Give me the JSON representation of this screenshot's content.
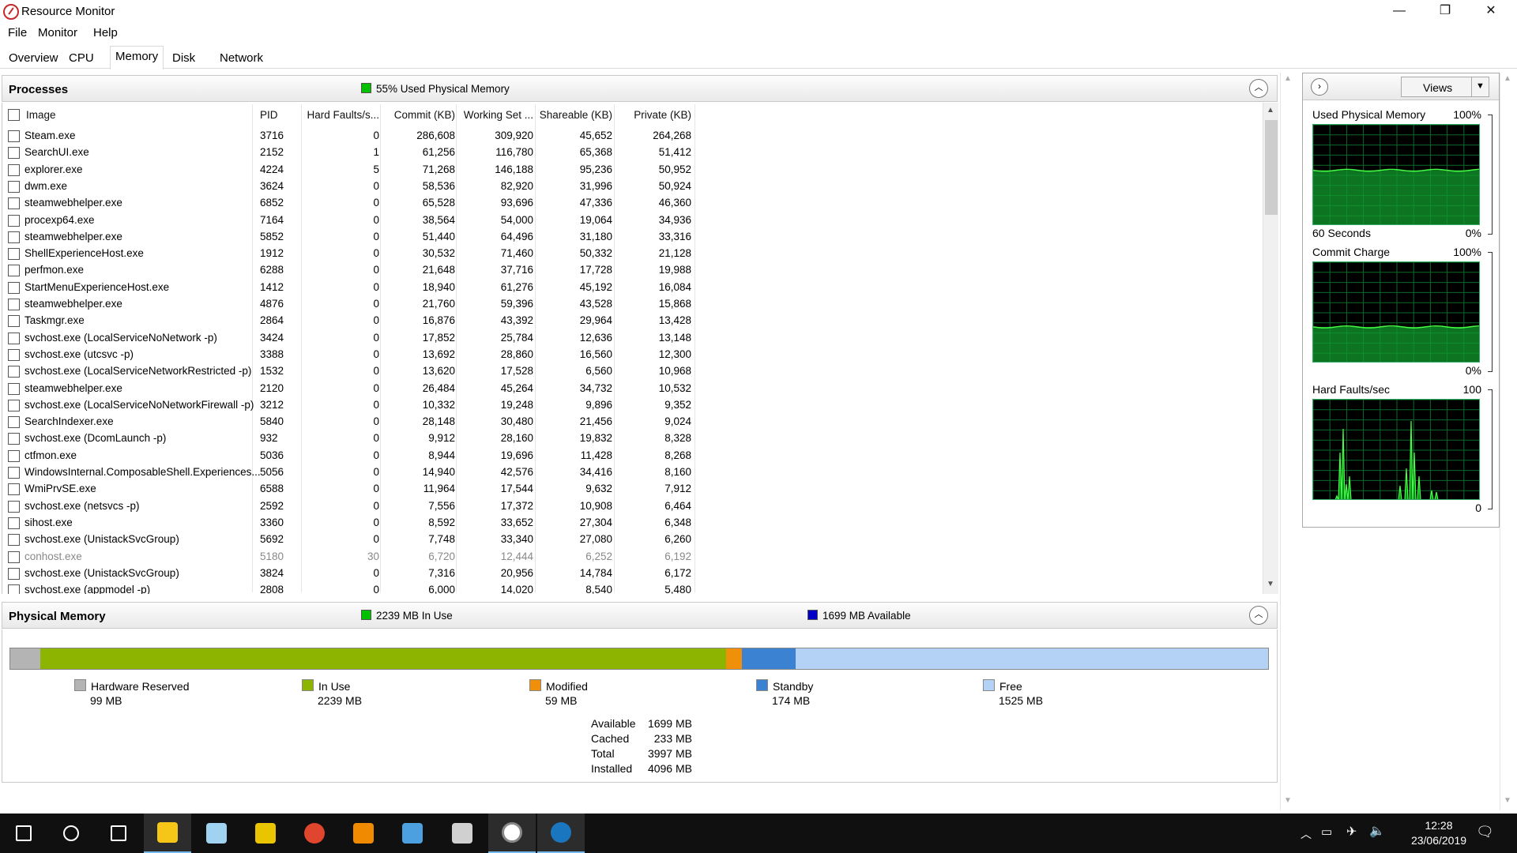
{
  "window": {
    "title": "Resource Monitor",
    "minimize_glyph": "—",
    "restore_glyph": "❐",
    "close_glyph": "✕"
  },
  "menu": [
    "File",
    "Monitor",
    "Help"
  ],
  "tabs": [
    {
      "label": "Overview",
      "active": false
    },
    {
      "label": "CPU",
      "active": false
    },
    {
      "label": "Memory",
      "active": true
    },
    {
      "label": "Disk",
      "active": false
    },
    {
      "label": "Network",
      "active": false
    }
  ],
  "processes": {
    "title": "Processes",
    "status": "55% Used Physical Memory",
    "status_color": "#00c000",
    "columns": [
      "Image",
      "PID",
      "Hard Faults/s...",
      "Commit (KB)",
      "Working Set ...",
      "Shareable (KB)",
      "Private (KB)"
    ],
    "rows": [
      [
        "Steam.exe",
        "3716",
        "0",
        "286,608",
        "309,920",
        "45,652",
        "264,268"
      ],
      [
        "SearchUI.exe",
        "2152",
        "1",
        "61,256",
        "116,780",
        "65,368",
        "51,412"
      ],
      [
        "explorer.exe",
        "4224",
        "5",
        "71,268",
        "146,188",
        "95,236",
        "50,952"
      ],
      [
        "dwm.exe",
        "3624",
        "0",
        "58,536",
        "82,920",
        "31,996",
        "50,924"
      ],
      [
        "steamwebhelper.exe",
        "6852",
        "0",
        "65,528",
        "93,696",
        "47,336",
        "46,360"
      ],
      [
        "procexp64.exe",
        "7164",
        "0",
        "38,564",
        "54,000",
        "19,064",
        "34,936"
      ],
      [
        "steamwebhelper.exe",
        "5852",
        "0",
        "51,440",
        "64,496",
        "31,180",
        "33,316"
      ],
      [
        "ShellExperienceHost.exe",
        "1912",
        "0",
        "30,532",
        "71,460",
        "50,332",
        "21,128"
      ],
      [
        "perfmon.exe",
        "6288",
        "0",
        "21,648",
        "37,716",
        "17,728",
        "19,988"
      ],
      [
        "StartMenuExperienceHost.exe",
        "1412",
        "0",
        "18,940",
        "61,276",
        "45,192",
        "16,084"
      ],
      [
        "steamwebhelper.exe",
        "4876",
        "0",
        "21,760",
        "59,396",
        "43,528",
        "15,868"
      ],
      [
        "Taskmgr.exe",
        "2864",
        "0",
        "16,876",
        "43,392",
        "29,964",
        "13,428"
      ],
      [
        "svchost.exe (LocalServiceNoNetwork -p)",
        "3424",
        "0",
        "17,852",
        "25,784",
        "12,636",
        "13,148"
      ],
      [
        "svchost.exe (utcsvc -p)",
        "3388",
        "0",
        "13,692",
        "28,860",
        "16,560",
        "12,300"
      ],
      [
        "svchost.exe (LocalServiceNetworkRestricted -p)",
        "1532",
        "0",
        "13,620",
        "17,528",
        "6,560",
        "10,968"
      ],
      [
        "steamwebhelper.exe",
        "2120",
        "0",
        "26,484",
        "45,264",
        "34,732",
        "10,532"
      ],
      [
        "svchost.exe (LocalServiceNoNetworkFirewall -p)",
        "3212",
        "0",
        "10,332",
        "19,248",
        "9,896",
        "9,352"
      ],
      [
        "SearchIndexer.exe",
        "5840",
        "0",
        "28,148",
        "30,480",
        "21,456",
        "9,024"
      ],
      [
        "svchost.exe (DcomLaunch -p)",
        "932",
        "0",
        "9,912",
        "28,160",
        "19,832",
        "8,328"
      ],
      [
        "ctfmon.exe",
        "5036",
        "0",
        "8,944",
        "19,696",
        "11,428",
        "8,268"
      ],
      [
        "WindowsInternal.ComposableShell.Experiences...",
        "5056",
        "0",
        "14,940",
        "42,576",
        "34,416",
        "8,160"
      ],
      [
        "WmiPrvSE.exe",
        "6588",
        "0",
        "11,964",
        "17,544",
        "9,632",
        "7,912"
      ],
      [
        "svchost.exe (netsvcs -p)",
        "2592",
        "0",
        "7,556",
        "17,372",
        "10,908",
        "6,464"
      ],
      [
        "sihost.exe",
        "3360",
        "0",
        "8,592",
        "33,652",
        "27,304",
        "6,348"
      ],
      [
        "svchost.exe (UnistackSvcGroup)",
        "5692",
        "0",
        "7,748",
        "33,340",
        "27,080",
        "6,260"
      ],
      [
        "conhost.exe",
        "5180",
        "30",
        "6,720",
        "12,444",
        "6,252",
        "6,192"
      ],
      [
        "svchost.exe (UnistackSvcGroup)",
        "3824",
        "0",
        "7,316",
        "20,956",
        "14,784",
        "6,172"
      ],
      [
        "svchost.exe (appmodel -p)",
        "2808",
        "0",
        "6,000",
        "14,020",
        "8,540",
        "5,480"
      ]
    ],
    "dim_row_index": 25
  },
  "physical_memory": {
    "title": "Physical Memory",
    "in_use_label": "2239 MB In Use",
    "available_label": "1699 MB Available",
    "in_use_color": "#00c000",
    "available_color": "#0000c8",
    "segments": [
      {
        "name": "Hardware Reserved",
        "value": "99 MB",
        "mb": 99,
        "color": "#b4b4b4"
      },
      {
        "name": "In Use",
        "value": "2239 MB",
        "mb": 2239,
        "color": "#8cb400"
      },
      {
        "name": "Modified",
        "value": "59 MB",
        "mb": 59,
        "color": "#f0900a"
      },
      {
        "name": "Standby",
        "value": "174 MB",
        "mb": 174,
        "color": "#3c82d2"
      },
      {
        "name": "Free",
        "value": "1525 MB",
        "mb": 1525,
        "color": "#b4d2f5"
      }
    ],
    "stats": [
      {
        "label": "Available",
        "value": "1699 MB"
      },
      {
        "label": "Cached",
        "value": "233 MB"
      },
      {
        "label": "Total",
        "value": "3997 MB"
      },
      {
        "label": "Installed",
        "value": "4096 MB"
      }
    ]
  },
  "graphs": {
    "views_label": "Views",
    "items": [
      {
        "title": "Used Physical Memory",
        "max": "100%",
        "bottom_left": "60 Seconds",
        "bottom_right": "0%",
        "level": 0.55
      },
      {
        "title": "Commit Charge",
        "max": "100%",
        "bottom_left": "",
        "bottom_right": "0%",
        "level": 0.36
      },
      {
        "title": "Hard Faults/sec",
        "max": "100",
        "bottom_left": "",
        "bottom_right": "0",
        "level": 0.0
      }
    ]
  },
  "taskbar": {
    "icons": [
      "windows-start-icon",
      "search-icon",
      "task-view-icon",
      "file-explorer-icon",
      "notepad-icon",
      "paint-icon",
      "chrome-icon",
      "vlc-icon",
      "control-panel-icon",
      "computer-icon",
      "resource-monitor-icon",
      "steam-icon"
    ],
    "time": "12:28",
    "date": "23/06/2019"
  }
}
